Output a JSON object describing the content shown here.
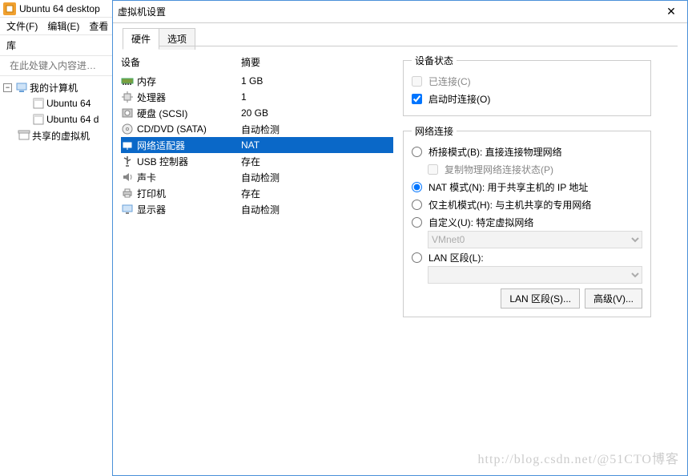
{
  "app": {
    "title": "Ubuntu 64 desktop",
    "menu": {
      "file": "文件(F)",
      "edit": "编辑(E)",
      "view": "查看"
    }
  },
  "library": {
    "label": "库",
    "search_placeholder": "在此处键入内容进…",
    "tree": {
      "root": "我的计算机",
      "items": [
        "Ubuntu 64",
        "Ubuntu 64 d"
      ],
      "shared": "共享的虚拟机"
    }
  },
  "dialog": {
    "title": "虚拟机设置",
    "tabs": {
      "hardware": "硬件",
      "options": "选项"
    },
    "headers": {
      "device": "设备",
      "summary": "摘要"
    },
    "devices": [
      {
        "name": "内存",
        "summary": "1 GB",
        "icon": "memory-icon"
      },
      {
        "name": "处理器",
        "summary": "1",
        "icon": "cpu-icon"
      },
      {
        "name": "硬盘 (SCSI)",
        "summary": "20 GB",
        "icon": "hdd-icon"
      },
      {
        "name": "CD/DVD (SATA)",
        "summary": "自动检测",
        "icon": "cd-icon"
      },
      {
        "name": "网络适配器",
        "summary": "NAT",
        "icon": "network-icon",
        "selected": true
      },
      {
        "name": "USB 控制器",
        "summary": "存在",
        "icon": "usb-icon"
      },
      {
        "name": "声卡",
        "summary": "自动检测",
        "icon": "sound-icon"
      },
      {
        "name": "打印机",
        "summary": "存在",
        "icon": "printer-icon"
      },
      {
        "name": "显示器",
        "summary": "自动检测",
        "icon": "display-icon"
      }
    ],
    "device_state": {
      "legend": "设备状态",
      "connected": "已连接(C)",
      "connect_on_start": "启动时连接(O)"
    },
    "net": {
      "legend": "网络连接",
      "bridge": "桥接模式(B): 直接连接物理网络",
      "replicate": "复制物理网络连接状态(P)",
      "nat": "NAT 模式(N): 用于共享主机的 IP 地址",
      "hostonly": "仅主机模式(H): 与主机共享的专用网络",
      "custom": "自定义(U): 特定虚拟网络",
      "custom_value": "VMnet0",
      "lan": "LAN 区段(L):",
      "btn_lan": "LAN 区段(S)...",
      "btn_adv": "高级(V)..."
    }
  },
  "watermark": "http://blog.csdn.net/@51CTO博客"
}
